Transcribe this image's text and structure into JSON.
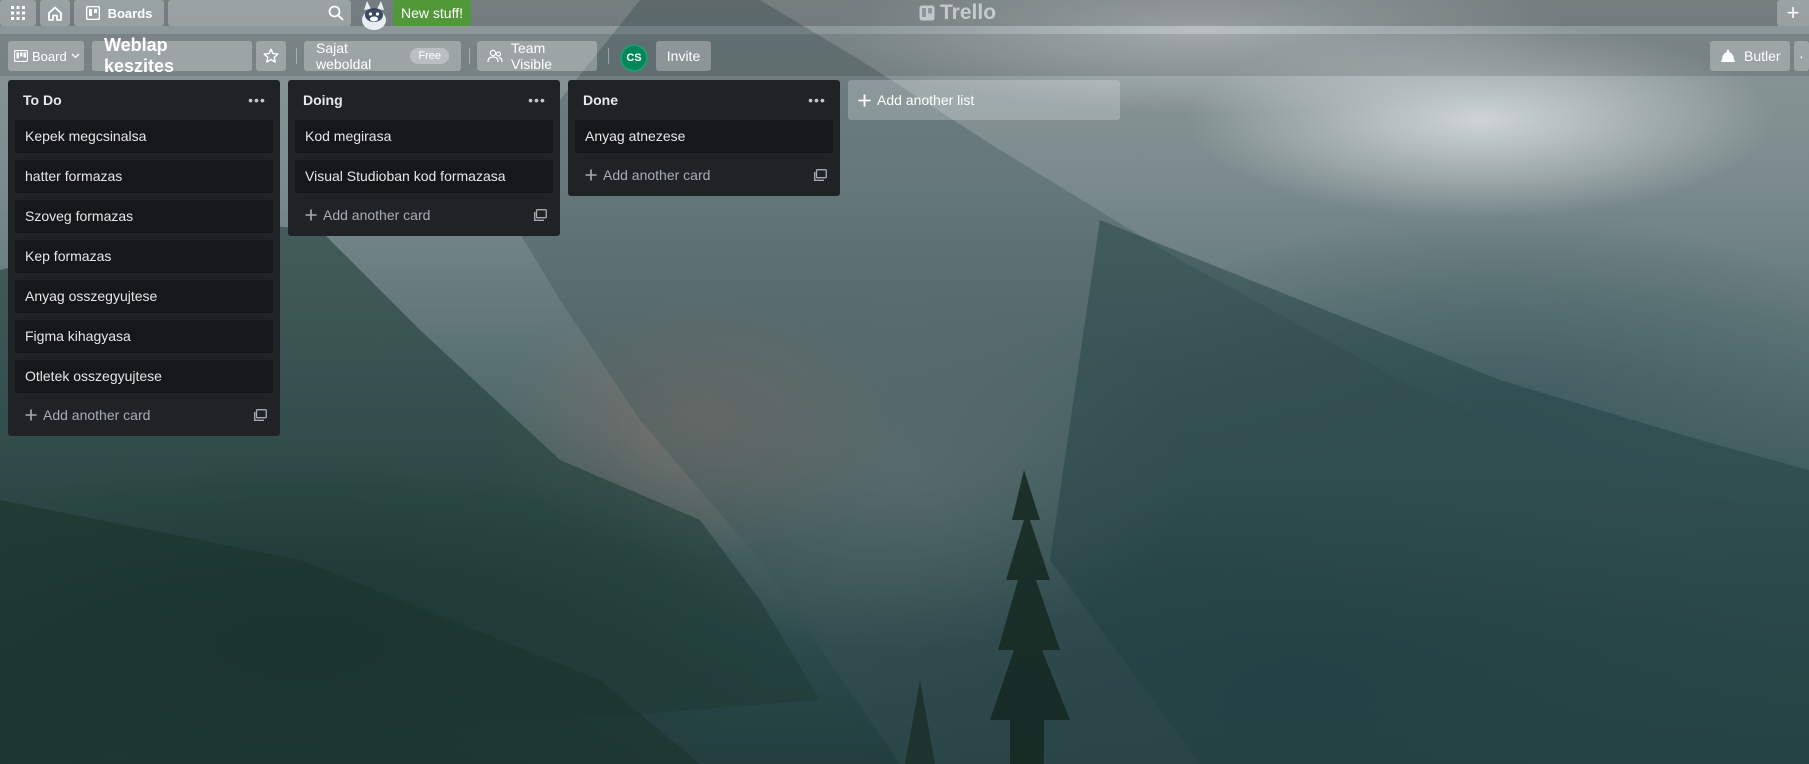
{
  "nav": {
    "boards_label": "Boards",
    "search": {
      "value": "",
      "placeholder": ""
    },
    "new_stuff_label": "New stuff!",
    "logo_text": "Trello",
    "plus_label": "+"
  },
  "board_header": {
    "view_label": "Board",
    "board_title": "Weblap keszites",
    "team_name": "Sajat weboldal",
    "team_plan": "Free",
    "visibility_label": "Team Visible",
    "member_initials": "CS",
    "invite_label": "Invite",
    "butler_label": "Butler"
  },
  "lists": [
    {
      "title": "To Do",
      "cards": [
        "Kepek megcsinalsa",
        "hatter formazas",
        "Szoveg formazas",
        "Kep formazas",
        "Anyag osszegyujtese",
        "Figma kihagyasa",
        "Otletek osszegyujtese"
      ],
      "add_card_label": "Add another card"
    },
    {
      "title": "Doing",
      "cards": [
        "Kod megirasa",
        "Visual Studioban kod formazasa"
      ],
      "add_card_label": "Add another card"
    },
    {
      "title": "Done",
      "cards": [
        "Anyag atnezese"
      ],
      "add_card_label": "Add another card"
    }
  ],
  "add_list_label": "Add another list",
  "colors": {
    "list_bg": "#1f2326",
    "card_bg": "#151719",
    "new_stuff_green": "#519839",
    "avatar_green": "#00875a"
  },
  "icons": [
    "apps-grid-icon",
    "home-icon",
    "boards-icon",
    "search-icon",
    "mascot-icon",
    "trello-logo-icon",
    "board-view-icon",
    "chevron-down-icon",
    "star-icon",
    "team-visible-icon",
    "butler-icon",
    "list-menu-icon",
    "plus-icon",
    "card-template-icon"
  ]
}
